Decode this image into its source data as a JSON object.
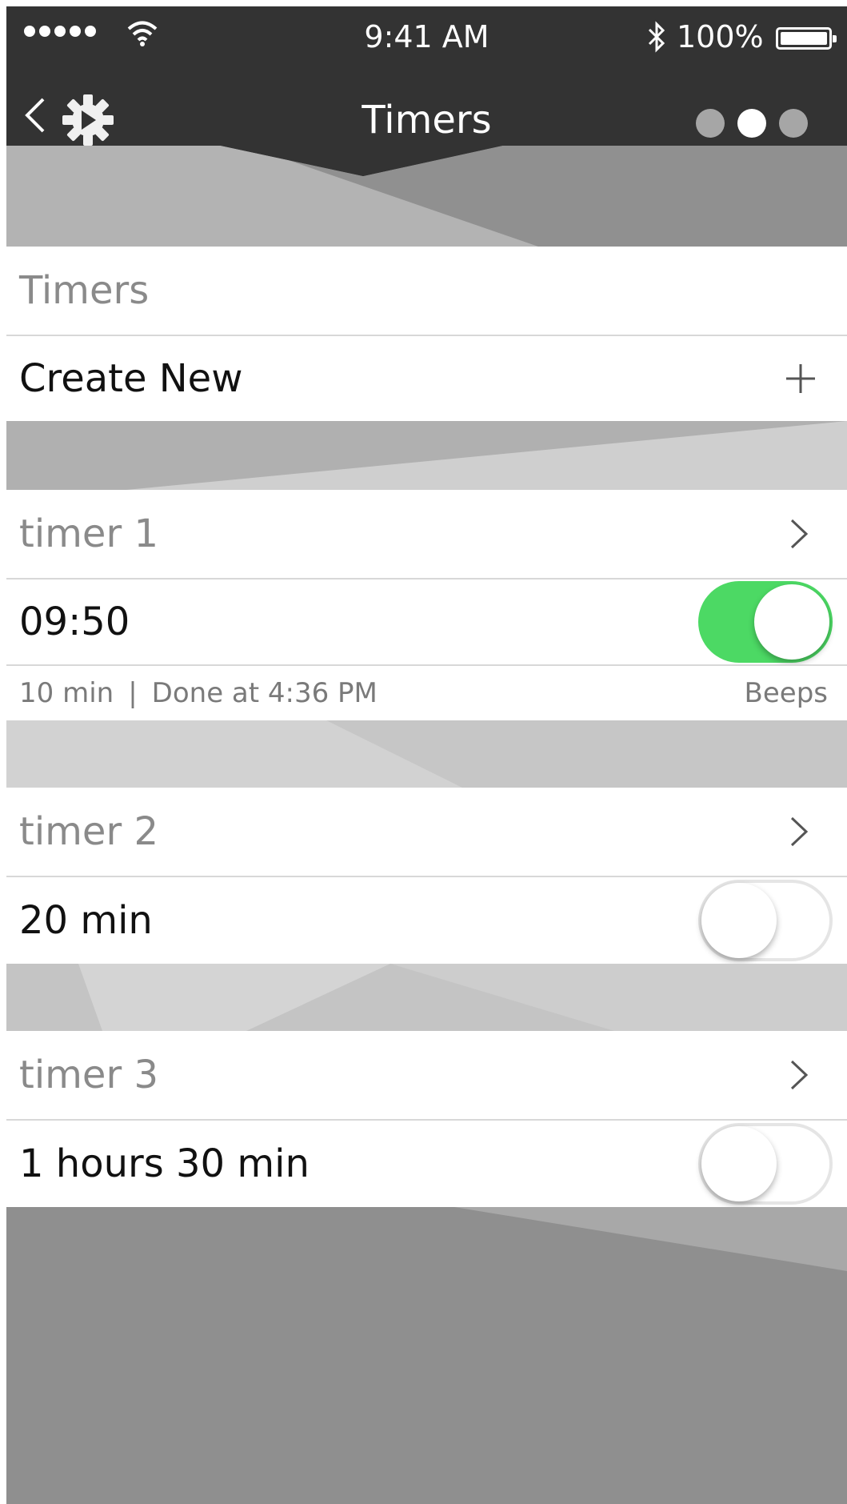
{
  "status_bar": {
    "time": "9:41 AM",
    "battery_percent": "100%"
  },
  "nav": {
    "title": "Timers",
    "page_count": 3,
    "active_page": 2
  },
  "section": {
    "header": "Timers",
    "create_new_label": "Create New"
  },
  "timers": [
    {
      "name": "timer 1",
      "value": "09:50",
      "enabled": true,
      "duration": "10 min",
      "separator": "|",
      "done_text": "Done at 4:36 PM",
      "sound": "Beeps"
    },
    {
      "name": "timer 2",
      "value": "20 min",
      "enabled": false
    },
    {
      "name": "timer 3",
      "value": "1 hours 30 min",
      "enabled": false
    }
  ],
  "colors": {
    "nav_background": "#333333",
    "toggle_on": "#4cd964",
    "toggle_off_border": "#e5e5e5",
    "muted_text": "#8a8a8a"
  },
  "icons": {
    "back": "chevron-left-icon",
    "logo": "gear-icon",
    "row_arrow": "chevron-right-icon",
    "add": "plus-icon"
  }
}
